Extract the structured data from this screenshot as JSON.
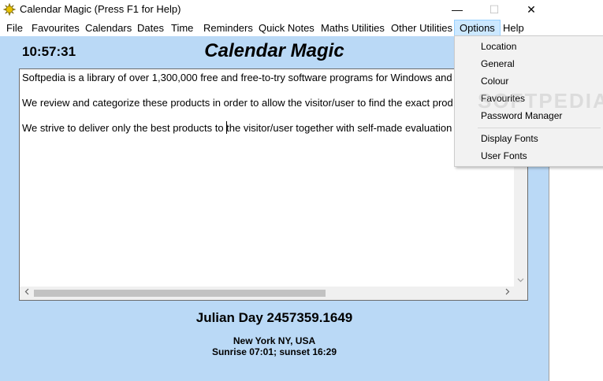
{
  "window": {
    "title": "Calendar Magic (Press F1 for Help)",
    "controls": {
      "minimize": "—",
      "maximize": "☐",
      "close": "✕"
    }
  },
  "menu": [
    {
      "label": "File"
    },
    {
      "label": "Favourites"
    },
    {
      "label": "Calendars"
    },
    {
      "label": "Dates"
    },
    {
      "label": "Time"
    },
    {
      "label": "Reminders"
    },
    {
      "label": "Quick Notes"
    },
    {
      "label": "Maths Utilities"
    },
    {
      "label": "Other Utilities"
    },
    {
      "label": "Options",
      "active": true
    },
    {
      "label": "Help"
    }
  ],
  "header": {
    "clock": "10:57:31",
    "app_title": "Calendar Magic"
  },
  "notes": {
    "lines": [
      "Softpedia is a library of over 1,300,000 free and free-to-try software programs for Windows and U",
      "We review and categorize these products in order to allow the visitor/user to find the exact prod",
      "We strive to deliver only the best products to the visitor/user together with self-made evaluation"
    ]
  },
  "footer": {
    "julian_day": "Julian Day 2457359.1649",
    "location": "New York NY, USA",
    "sun_times": "Sunrise 07:01; sunset 16:29"
  },
  "options_menu": {
    "group1": [
      "Location",
      "General",
      "Colour",
      "Favourites",
      "Password Manager"
    ],
    "group2": [
      "Display Fonts",
      "User Fonts"
    ]
  },
  "watermark": "SOFTPEDIA",
  "colors": {
    "client_bg": "#bad9f6",
    "menu_active_bg": "#cce8ff",
    "dropdown_bg": "#f2f2f2"
  },
  "icons": {
    "app": "sun-gear-icon",
    "scroll_left": "chevron-left-icon",
    "scroll_right": "chevron-right-icon",
    "scroll_down": "chevron-down-icon"
  }
}
